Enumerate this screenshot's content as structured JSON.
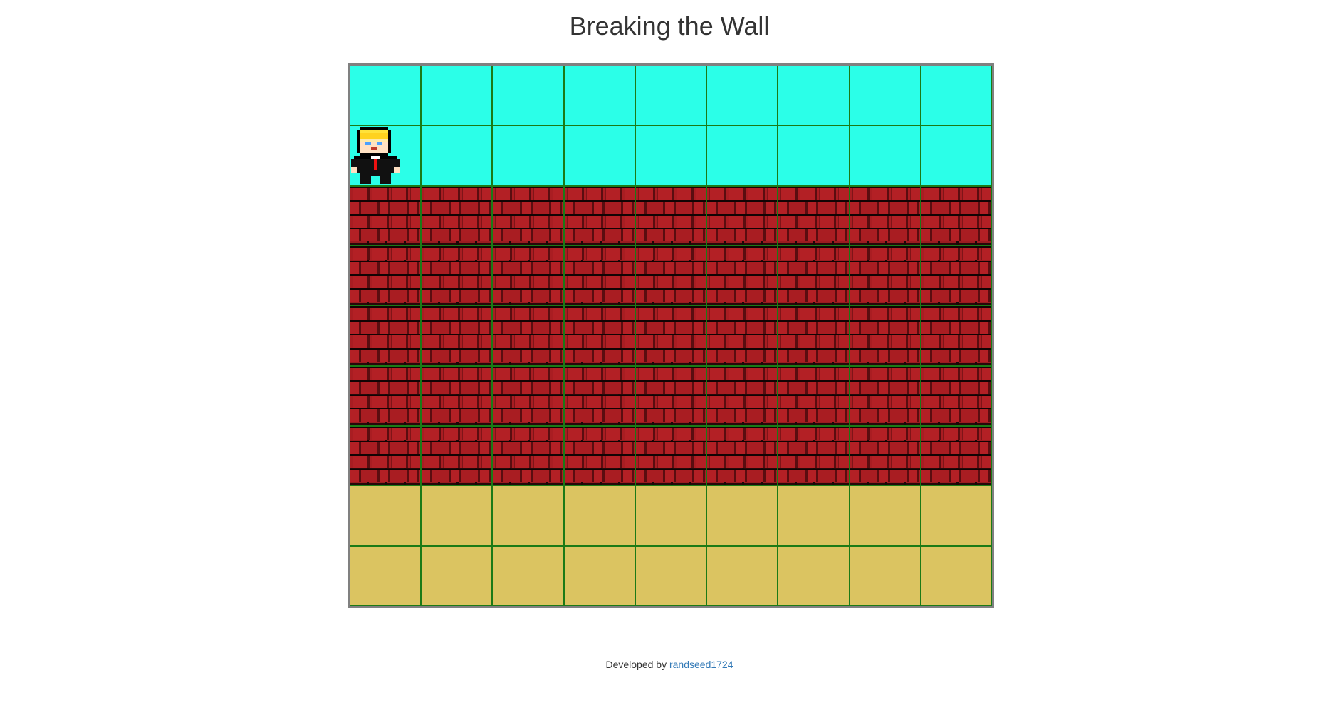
{
  "title": "Breaking the Wall",
  "footer": {
    "prefix": "Developed by ",
    "author": "randseed1724"
  },
  "board": {
    "columns": 9,
    "rows": [
      "sky",
      "sky",
      "brick",
      "brick",
      "brick",
      "brick",
      "brick",
      "sand",
      "sand"
    ],
    "player": {
      "row": 1,
      "col": 0,
      "icon": "player-character-icon"
    }
  },
  "colors": {
    "sky": "#2bffe8",
    "sand": "#dbc461",
    "brick": "#a91d22",
    "grid_line": "#1c7a16",
    "link": "#337ab7"
  }
}
